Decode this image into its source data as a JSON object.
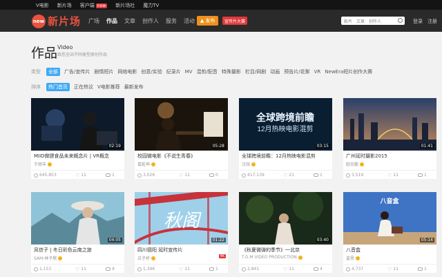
{
  "topbar": {
    "links": [
      "V电影",
      "新片场",
      "客户端",
      "新片场社",
      "魔力TV"
    ],
    "client_badge": "new"
  },
  "header": {
    "logo_mark": "new",
    "logo_text": "新片场",
    "nav": [
      "广场",
      "作品",
      "文章",
      "创作人",
      "服务",
      "活动"
    ],
    "active_nav": "作品",
    "publish_label": "发布",
    "campaign_label": "宣传片大赛",
    "search_options": [
      "影片",
      "文章",
      "创作人"
    ],
    "login": "登录",
    "register": "注册"
  },
  "page": {
    "title": "作品",
    "subtitle_en": "Video",
    "subtitle_cn": "致您全站不同类型原创作品"
  },
  "filters": {
    "category_label": "类型",
    "categories": [
      "全部",
      "广告/宣传片",
      "剧情短片",
      "网络电影",
      "创意/实验",
      "纪录片",
      "MV",
      "混剪/配音",
      "特殊摄影",
      "栏目/网剧",
      "动画",
      "预告片/花絮",
      "VR",
      "NewEra短片创作大赛"
    ],
    "sort_label": "排序",
    "sorts": [
      "热门首页",
      "正在热议",
      "V电影推荐",
      "最新发布"
    ]
  },
  "cards": [
    {
      "title": "MIID做健食品未来概念片 | VR概念",
      "author": "于丽丰",
      "duration": "02:19",
      "views": "645,853",
      "likes": "11",
      "comments": "1"
    },
    {
      "title": "校园微电影《不说生青春》",
      "author": "葛乾坤",
      "duration": "05:28",
      "views": "3,026",
      "likes": "11",
      "comments": "0"
    },
    {
      "title": "全球跨境前瞻：12月热映电影混剪",
      "author": "汉铭",
      "duration": "03:15",
      "views": "417,139",
      "likes": "21",
      "comments": "1"
    },
    {
      "title": "广州延时摄影2015",
      "author": "欧尚鹏",
      "duration": "01:41",
      "views": "3,519",
      "likes": "11",
      "comments": "1"
    },
    {
      "title": "风信子 | 冬日彩色云南之旅",
      "author": "SAM-林子默",
      "duration": "04:05",
      "views": "1,153",
      "likes": "11",
      "comments": "9"
    },
    {
      "title": "四川德阳 延时宣传片",
      "author": "吕子桥",
      "duration": "01:22",
      "views": "1,396",
      "likes": "11",
      "comments": "1",
      "tag": "4K"
    },
    {
      "title": "《秋夏微弹的季节》一北京",
      "author": "T.G.M VIDEO PRODUCTION",
      "duration": "03:40",
      "views": "2,841",
      "likes": "11",
      "comments": "4"
    },
    {
      "title": "八音盒",
      "author": "姿恩",
      "duration": "05:14",
      "views": "4,737",
      "likes": "11",
      "comments": "1"
    }
  ],
  "thumb_text": {
    "card3_line1": "全球跨境前瞻",
    "card3_line2": "12月热映电影混剪",
    "card6_calligraphy": "秋阁",
    "card8_logo": "八音盒"
  },
  "colors": {
    "brand": "#e8523f",
    "accent_blue": "#3fa9f5",
    "publish_orange": "#f0901c",
    "header_bg": "#2a2a2a"
  }
}
